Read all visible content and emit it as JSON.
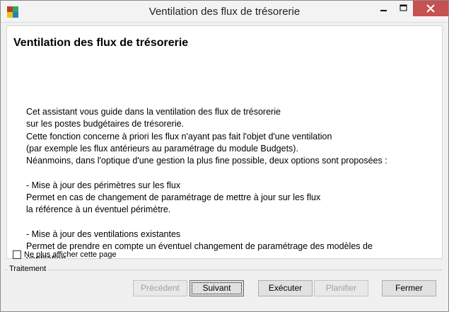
{
  "window": {
    "title": "Ventilation des flux de trésorerie"
  },
  "main": {
    "heading": "Ventilation des flux de trésorerie",
    "description_lines": [
      "Cet assistant vous guide dans la ventilation des flux de trésorerie",
      "sur les postes budgétaires de trésorerie.",
      "Cette fonction concerne à priori les flux n'ayant pas fait l'objet d'une ventilation",
      "(par exemple les flux antérieurs au paramétrage du module Budgets).",
      "Néanmoins, dans l'optique d'une gestion la plus fine possible, deux options sont proposées :",
      "",
      "- Mise à jour des périmètres sur les flux",
      "Permet en cas de changement de paramétrage de mettre à jour sur les flux",
      "la référence à un éventuel périmètre.",
      "",
      "- Mise à jour des ventilations existantes",
      "Permet de prendre en compte un éventuel changement de paramétrage des modèles de",
      "ventilation."
    ]
  },
  "options": {
    "dont_show_label": "Ne plus afficher cette page",
    "dont_show_checked": false
  },
  "footer": {
    "group_label": "Traitement",
    "buttons": {
      "previous": "Précédent",
      "next": "Suivant",
      "execute": "Exécuter",
      "schedule": "Planifier",
      "close": "Fermer"
    }
  },
  "icons": {
    "app": "app-icon",
    "minimize": "minimize-icon",
    "maximize": "maximize-icon",
    "close": "close-icon"
  },
  "colors": {
    "close_button": "#c75050",
    "window_bg": "#f0f0f0",
    "panel_bg": "#ffffff"
  }
}
